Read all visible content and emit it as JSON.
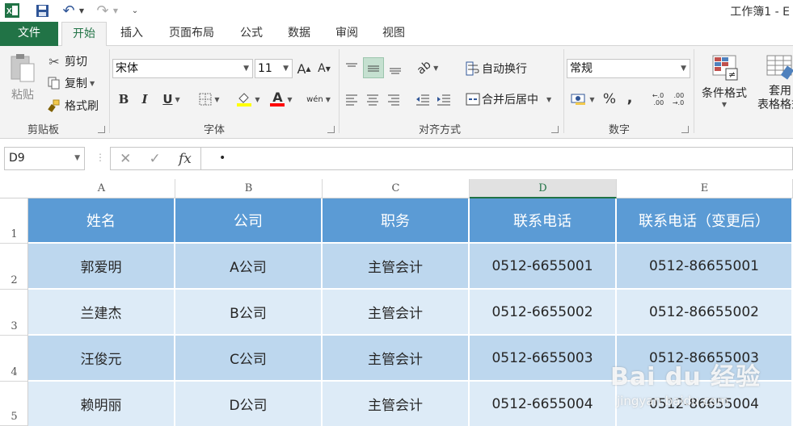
{
  "app": {
    "title": "工作簿1 - E"
  },
  "tabs": [
    "文件",
    "开始",
    "插入",
    "页面布局",
    "公式",
    "数据",
    "审阅",
    "视图"
  ],
  "ribbon": {
    "clipboard": {
      "label": "剪贴板",
      "paste": "粘贴",
      "cut": "剪切",
      "copy": "复制",
      "format_painter": "格式刷"
    },
    "font": {
      "label": "字体",
      "name": "宋体",
      "size": "11",
      "bold": "B",
      "italic": "I",
      "underline": "U",
      "font_color_glyph": "A",
      "grow_glyph": "A",
      "shrink_glyph": "A",
      "phonetic_glyph": "wén"
    },
    "alignment": {
      "label": "对齐方式",
      "wrap_text": "自动换行",
      "merge_center": "合并后居中"
    },
    "number": {
      "label": "数字",
      "format": "常规",
      "percent": "%",
      "comma": ",",
      "inc_decimal": "←.0\n.00",
      "dec_decimal": ".00\n→.0"
    },
    "styles": {
      "conditional_format": "条件格式",
      "table_format": "套用\n表格格式"
    },
    "accent": "#217346"
  },
  "formula_bar": {
    "name_box": "D9",
    "fx": "fx",
    "content": "•"
  },
  "grid": {
    "columns": [
      "A",
      "B",
      "C",
      "D",
      "E"
    ],
    "selected_column": "D",
    "rows": [
      "1",
      "2",
      "3",
      "4",
      "5"
    ],
    "header": [
      "姓名",
      "公司",
      "职务",
      "联系电话",
      "联系电话（变更后）"
    ],
    "data": [
      [
        "郭爱明",
        "A公司",
        "主管会计",
        "0512-6655001",
        "0512-86655001"
      ],
      [
        "兰建杰",
        "B公司",
        "主管会计",
        "0512-6655002",
        "0512-86655002"
      ],
      [
        "汪俊元",
        "C公司",
        "主管会计",
        "0512-6655003",
        "0512-86655003"
      ],
      [
        "赖明丽",
        "D公司",
        "主管会计",
        "0512-6655004",
        "0512-86655004"
      ]
    ],
    "header_color": "#5b9bd5",
    "band_colors": [
      "#bdd7ee",
      "#ddebf7"
    ]
  },
  "watermark": {
    "brand": "Bai du 经验",
    "url": "jingyan.baidu.com"
  }
}
